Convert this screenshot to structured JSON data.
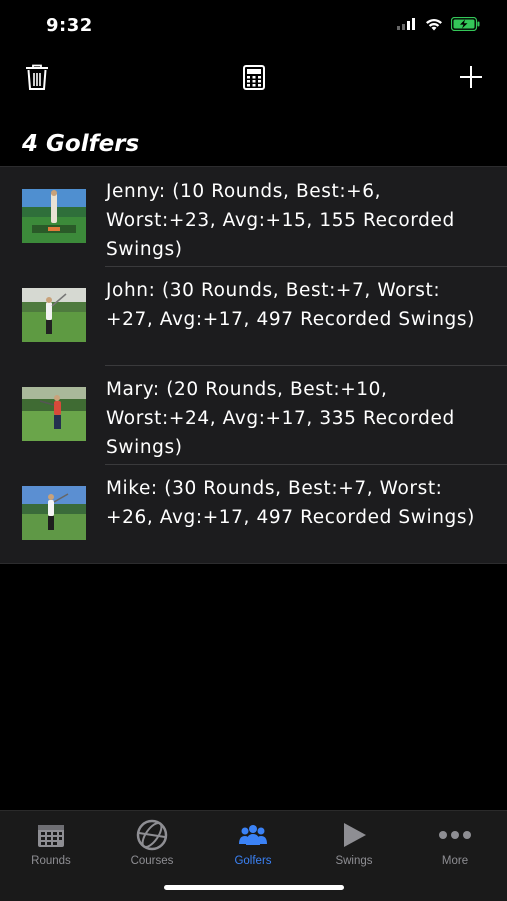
{
  "status": {
    "time": "9:32"
  },
  "section_title": "4 Golfers",
  "golfers": [
    {
      "text": "Jenny: (10 Rounds, Best:+6, Worst:+23, Avg:+15, 155 Recorded Swings)"
    },
    {
      "text": "John: (30 Rounds, Best:+7, Worst: +27, Avg:+17, 497 Recorded Swings)"
    },
    {
      "text": "Mary: (20 Rounds, Best:+10, Worst:+24, Avg:+17, 335 Recorded Swings)"
    },
    {
      "text": "Mike: (30 Rounds, Best:+7, Worst: +26, Avg:+17, 497 Recorded Swings)"
    }
  ],
  "tabs": [
    {
      "label": "Rounds",
      "icon": "calendar-icon"
    },
    {
      "label": "Courses",
      "icon": "globe-icon"
    },
    {
      "label": "Golfers",
      "icon": "people-icon",
      "active": true
    },
    {
      "label": "Swings",
      "icon": "play-icon"
    },
    {
      "label": "More",
      "icon": "more-icon"
    }
  ],
  "colors": {
    "accent": "#3b82f6",
    "inactive": "#8e8e93",
    "battery": "#34c759"
  }
}
